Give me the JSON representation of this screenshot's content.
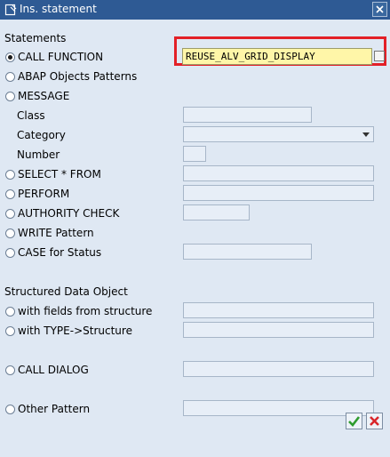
{
  "window": {
    "title": "Ins. statement"
  },
  "statements": {
    "heading": "Statements",
    "call_function": {
      "label": "CALL FUNCTION",
      "value": "REUSE_ALV_GRID_DISPLAY"
    },
    "abap_objects": {
      "label": "ABAP Objects Patterns"
    },
    "message": {
      "label": "MESSAGE"
    },
    "class": {
      "label": "Class"
    },
    "category": {
      "label": "Category"
    },
    "number": {
      "label": "Number"
    },
    "select": {
      "label": "SELECT * FROM"
    },
    "perform": {
      "label": "PERFORM"
    },
    "authority": {
      "label": "AUTHORITY CHECK"
    },
    "write": {
      "label": "WRITE Pattern"
    },
    "case": {
      "label": "CASE for Status"
    }
  },
  "structured": {
    "heading": "Structured Data Object",
    "with_fields": {
      "label": "with fields from structure"
    },
    "with_type": {
      "label": "with TYPE->Structure"
    }
  },
  "call_dialog": {
    "label": "CALL DIALOG"
  },
  "other_pattern": {
    "label": "Other Pattern"
  },
  "icons": {
    "title": "insert-statement-icon",
    "close": "close-icon",
    "value_help": "value-help-icon",
    "confirm": "checkmark-icon",
    "cancel": "cancel-icon"
  },
  "colors": {
    "title_bar": "#2e5a94",
    "background": "#dfe8f3",
    "highlight": "#e32027",
    "input_fill": "#fff6a8"
  }
}
